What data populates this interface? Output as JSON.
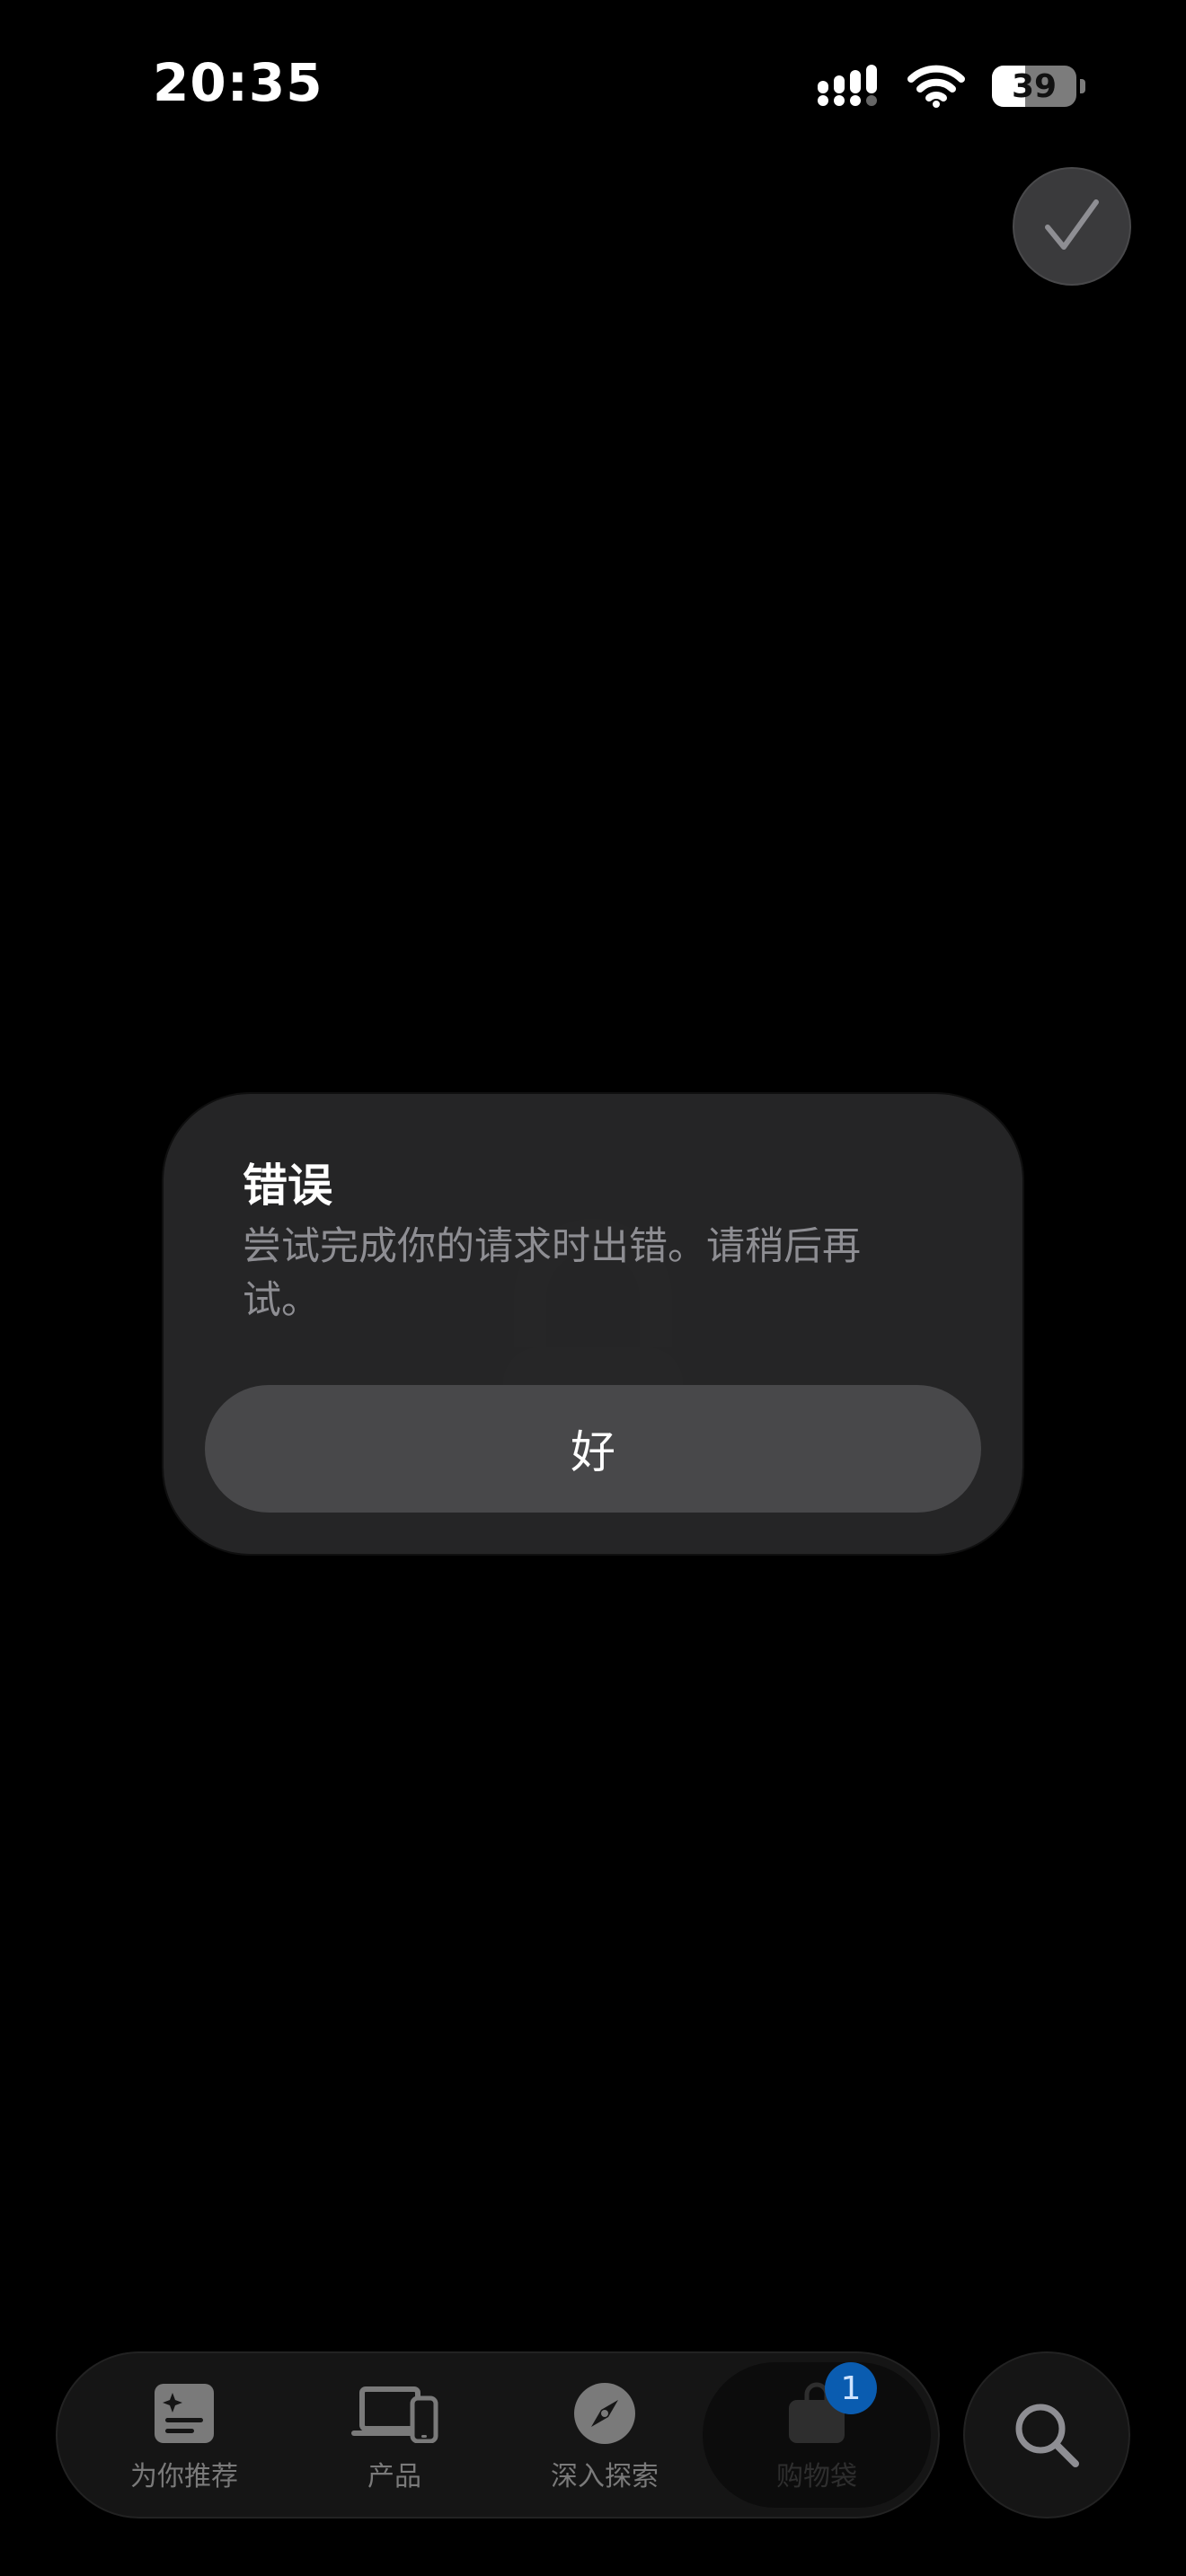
{
  "status_bar": {
    "time": "20:35",
    "battery_level": "39"
  },
  "alert": {
    "title": "错误",
    "message": "尝试完成你的请求时出错。请稍后再试。",
    "ok_label": "好"
  },
  "tab_bar": {
    "items": [
      {
        "label": "为你推荐",
        "icon": "for-you-icon"
      },
      {
        "label": "产品",
        "icon": "devices-icon"
      },
      {
        "label": "深入探索",
        "icon": "compass-icon"
      },
      {
        "label": "购物袋",
        "icon": "bag-icon",
        "badge": "1"
      }
    ]
  },
  "colors": {
    "background": "#000000",
    "alert_bg": "#262628",
    "button_bg": "#48484a",
    "badge": "#0a5cb0"
  }
}
